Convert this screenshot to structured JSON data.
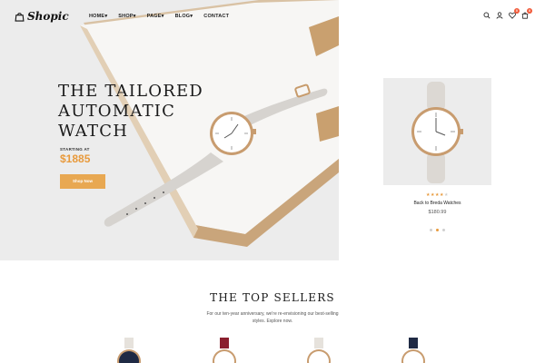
{
  "brand": {
    "name": "Shopic"
  },
  "nav": {
    "items": [
      {
        "label": "HOME",
        "has_dropdown": true
      },
      {
        "label": "SHOP",
        "has_dropdown": true
      },
      {
        "label": "PAGE",
        "has_dropdown": true
      },
      {
        "label": "BLOG",
        "has_dropdown": true
      },
      {
        "label": "CONTACT",
        "has_dropdown": false
      }
    ],
    "dropdown_glyph": "▾"
  },
  "header_icons": {
    "icons": [
      "search-icon",
      "user-icon",
      "heart-icon",
      "cart-icon"
    ],
    "wishlist_count": "0",
    "cart_count": "0"
  },
  "hero": {
    "title": "THE TAILORED\nAUTOMATIC\nWATCH",
    "starting_label": "STARTING AT",
    "price": "$1885",
    "button_label": "Shop Now"
  },
  "featured_product": {
    "rating": 4,
    "rating_max": 5,
    "name": "Back to Breda Watches",
    "price": "$180.99",
    "carousel_index": 2,
    "carousel_count": 3
  },
  "top_sellers": {
    "title": "THE TOP SELLERS",
    "subtitle": "For our ten-year anniversary, we're re-envisioning our best-selling styles. Explore now.",
    "products": [
      {
        "strap_color": "#e6e2dc",
        "dial_color": "#1f2a44"
      },
      {
        "strap_color": "#8a1f2e",
        "dial_color": "#ffffff"
      },
      {
        "strap_color": "#e6e2dc",
        "dial_color": "#ffffff"
      },
      {
        "strap_color": "#1f2a44",
        "dial_color": "#ffffff"
      }
    ]
  },
  "colors": {
    "accent": "#e89a3c",
    "button": "#e8a852",
    "badge": "#f15a3a",
    "hero_bg": "#ececec"
  }
}
